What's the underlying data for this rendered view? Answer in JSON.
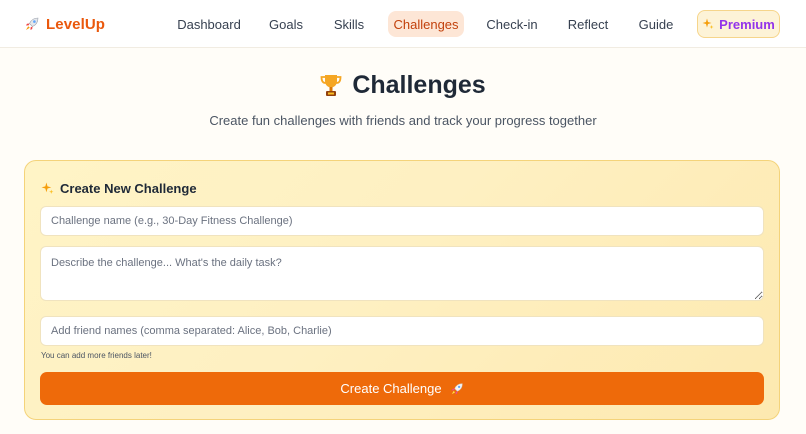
{
  "brand": {
    "name": "LevelUp",
    "icon": "rocket-icon"
  },
  "nav": {
    "items": [
      {
        "label": "Dashboard"
      },
      {
        "label": "Goals"
      },
      {
        "label": "Skills"
      },
      {
        "label": "Challenges",
        "active": true
      },
      {
        "label": "Check-in"
      },
      {
        "label": "Reflect"
      },
      {
        "label": "Guide"
      }
    ],
    "premium_label": "Premium",
    "premium_icon": "sparkles-icon"
  },
  "hero": {
    "icon": "trophy-icon",
    "title": "Challenges",
    "subtitle": "Create fun challenges with friends and track your progress together"
  },
  "form": {
    "heading_icon": "sparkles-icon",
    "heading": "Create New Challenge",
    "name_placeholder": "Challenge name (e.g., 30-Day Fitness Challenge)",
    "name_value": "",
    "description_placeholder": "Describe the challenge... What's the daily task?",
    "description_value": "",
    "friends_placeholder": "Add friend names (comma separated: Alice, Bob, Charlie)",
    "friends_value": "",
    "hint": "You can add more friends later!",
    "submit_label": "Create Challenge",
    "submit_icon": "rocket-icon"
  },
  "colors": {
    "brand": "#ea580c",
    "active_nav_bg": "#fde6d6",
    "premium": "#9333ea",
    "card_bg": "#fef0c2",
    "card_border": "#f4d37a",
    "button": "#ee6a0a"
  }
}
